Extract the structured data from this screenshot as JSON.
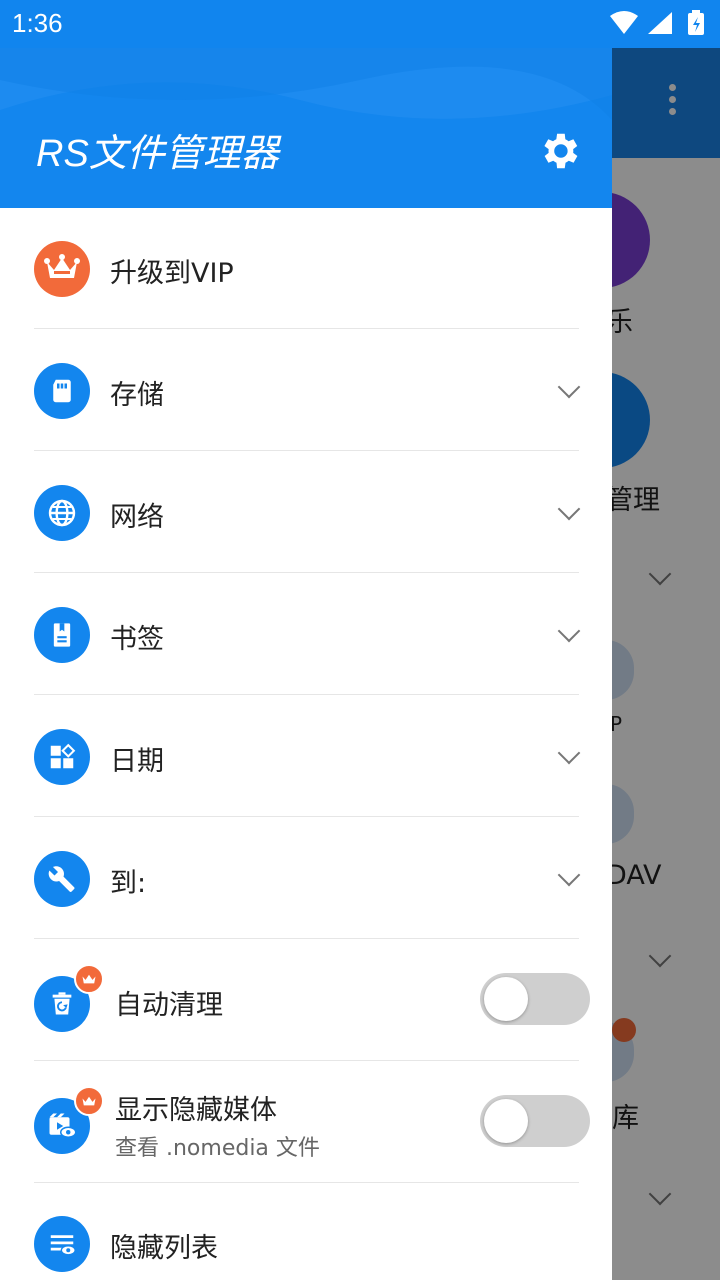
{
  "status_bar": {
    "time": "1:36"
  },
  "drawer": {
    "title": "RS文件管理器",
    "vip_label": "升级到VIP",
    "items": [
      {
        "label": "存储",
        "icon": "sd-card-icon"
      },
      {
        "label": "网络",
        "icon": "globe-icon"
      },
      {
        "label": "书签",
        "icon": "bookmark-icon"
      },
      {
        "label": "日期",
        "icon": "widgets-icon"
      },
      {
        "label": "到:",
        "icon": "wrench-icon"
      }
    ],
    "auto_clean": {
      "label": "自动清理",
      "enabled": false
    },
    "show_hidden_media": {
      "label": "显示隐藏媒体",
      "sublabel": "查看 .nomedia 文件",
      "enabled": false
    },
    "hidden_list": {
      "label": "隐藏列表"
    }
  },
  "background": {
    "texts": [
      "乐",
      "管理",
      "P",
      "DAV",
      "库"
    ]
  },
  "colors": {
    "primary": "#1386ee",
    "vip_orange": "#f26a3a",
    "purple": "#7b3fd6"
  }
}
